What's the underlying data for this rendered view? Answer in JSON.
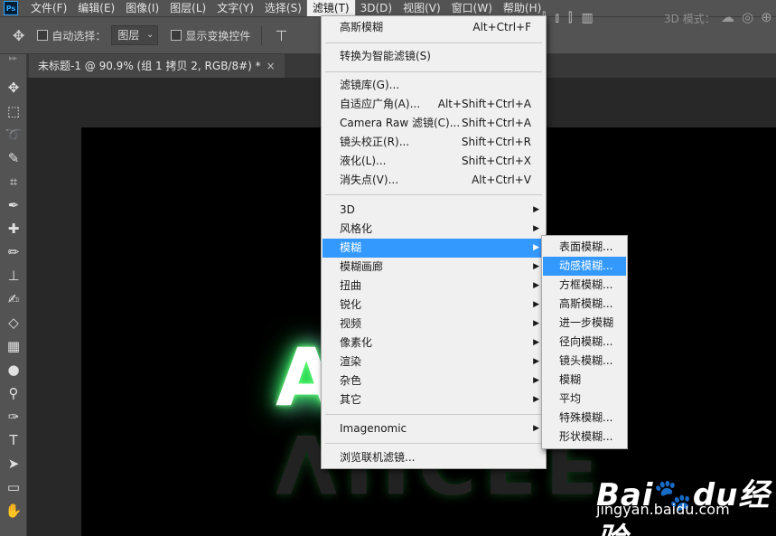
{
  "app_logo": "Ps",
  "menubar": {
    "items": [
      "文件(F)",
      "编辑(E)",
      "图像(I)",
      "图层(L)",
      "文字(Y)",
      "选择(S)",
      "滤镜(T)",
      "3D(D)",
      "视图(V)",
      "窗口(W)",
      "帮助(H)"
    ],
    "active_index": 6
  },
  "options": {
    "auto_select_label": "自动选择：",
    "auto_select_value": "图层",
    "show_transform_label": "显示变换控件",
    "mode3d_label": "3D 模式："
  },
  "document": {
    "tab_title": "未标题-1 @ 90.9% (组 1 拷贝 2, RGB/8#) *",
    "close_glyph": "×"
  },
  "canvas": {
    "glow_text": "A  L",
    "reflection_text": "VIICEF"
  },
  "filter_menu": {
    "last_filter": {
      "label": "高斯模糊",
      "shortcut": "Alt+Ctrl+F"
    },
    "smart_filter": {
      "label": "转换为智能滤镜(S)"
    },
    "group2": [
      {
        "label": "滤镜库(G)...",
        "shortcut": ""
      },
      {
        "label": "自适应广角(A)...",
        "shortcut": "Alt+Shift+Ctrl+A"
      },
      {
        "label": "Camera Raw 滤镜(C)...",
        "shortcut": "Shift+Ctrl+A"
      },
      {
        "label": "镜头校正(R)...",
        "shortcut": "Shift+Ctrl+R"
      },
      {
        "label": "液化(L)...",
        "shortcut": "Shift+Ctrl+X"
      },
      {
        "label": "消失点(V)...",
        "shortcut": "Alt+Ctrl+V"
      }
    ],
    "group3": [
      {
        "label": "3D"
      },
      {
        "label": "风格化"
      },
      {
        "label": "模糊"
      },
      {
        "label": "模糊画廊"
      },
      {
        "label": "扭曲"
      },
      {
        "label": "锐化"
      },
      {
        "label": "视频"
      },
      {
        "label": "像素化"
      },
      {
        "label": "渲染"
      },
      {
        "label": "杂色"
      },
      {
        "label": "其它"
      }
    ],
    "highlighted_group3_index": 2,
    "plugin": {
      "label": "Imagenomic"
    },
    "browse": {
      "label": "浏览联机滤镜..."
    }
  },
  "blur_submenu": {
    "items": [
      "表面模糊...",
      "动感模糊...",
      "方框模糊...",
      "高斯模糊...",
      "进一步模糊",
      "径向模糊...",
      "镜头模糊...",
      "模糊",
      "平均",
      "特殊模糊...",
      "形状模糊..."
    ],
    "highlighted_index": 1
  },
  "watermark": {
    "brand": "Bai",
    "brand_suffix": "du",
    "brand_cn": "经验",
    "url": "jingyan.baidu.com"
  },
  "colors": {
    "highlight": "#3399ff",
    "menu_bg": "#f0f0f0",
    "ui_bg": "#535353",
    "glow_green": "#00ff3c",
    "glow_purple": "#c020ff"
  },
  "icons": [
    "move-tool-icon",
    "marquee-tool-icon",
    "lasso-tool-icon",
    "quick-select-tool-icon",
    "crop-tool-icon",
    "eyedropper-tool-icon",
    "healing-brush-tool-icon",
    "brush-tool-icon",
    "clone-stamp-tool-icon",
    "history-brush-tool-icon",
    "eraser-tool-icon",
    "gradient-tool-icon",
    "blur-tool-icon",
    "dodge-tool-icon",
    "pen-tool-icon",
    "type-tool-icon",
    "path-select-tool-icon",
    "rectangle-tool-icon",
    "hand-tool-icon"
  ]
}
